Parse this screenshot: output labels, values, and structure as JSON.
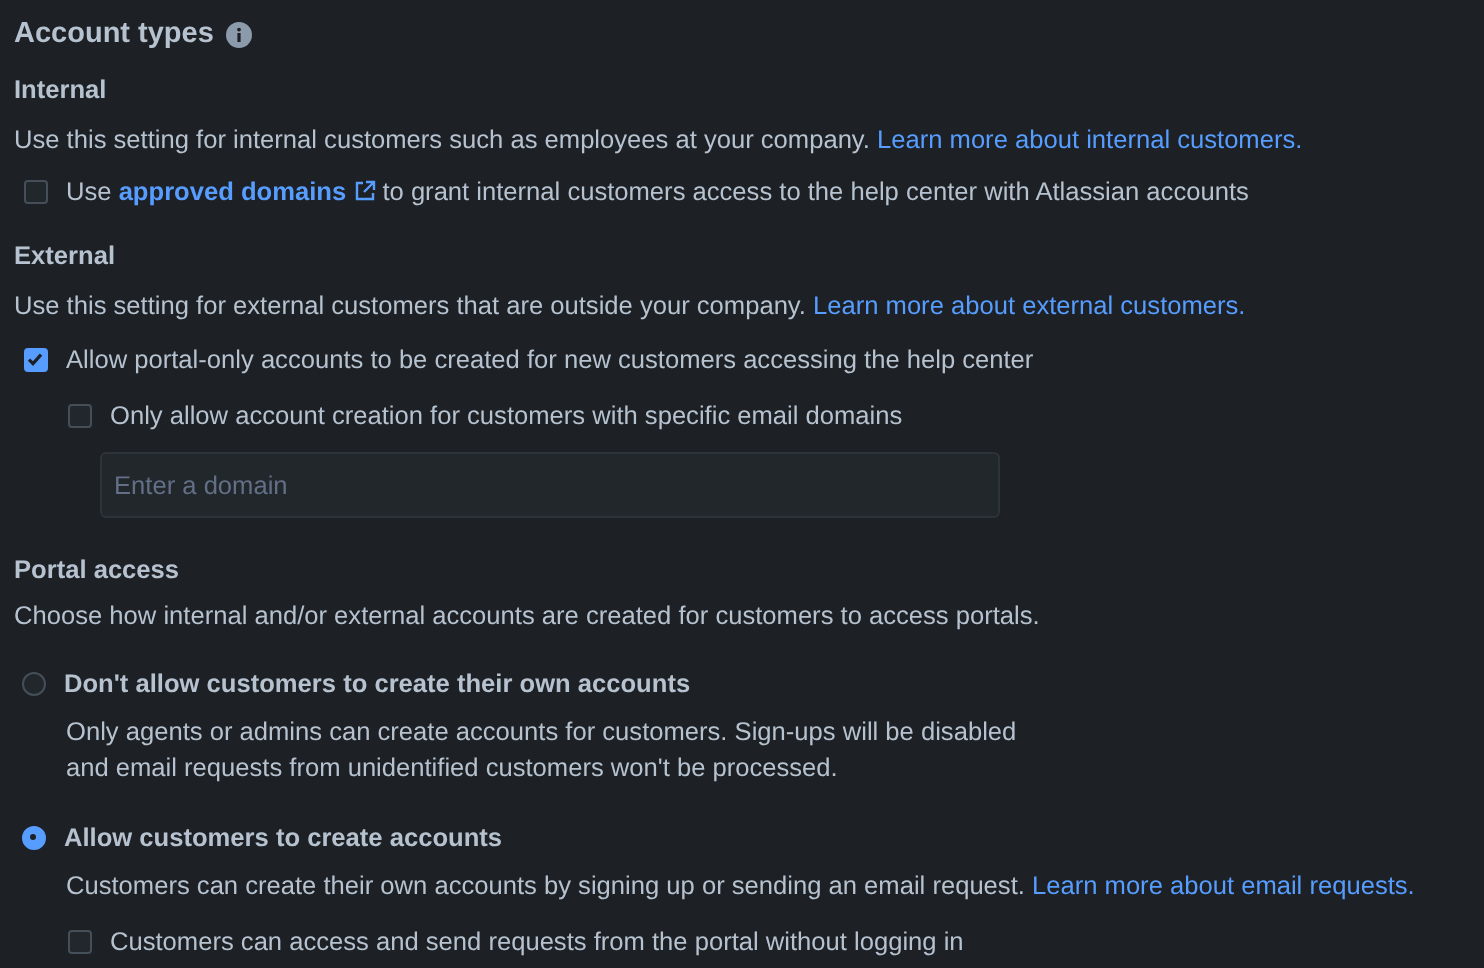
{
  "title": "Account types",
  "internal": {
    "heading": "Internal",
    "description": {
      "text": "Use this setting for internal customers such as employees at your company.",
      "link": "Learn more about internal customers."
    },
    "option": {
      "before": "Use",
      "link": "approved domains",
      "after": "to grant internal customers access to the help center with Atlassian accounts",
      "checked": false
    }
  },
  "external": {
    "heading": "External",
    "description": {
      "text": "Use this setting for external customers that are outside your company.",
      "link": "Learn more about external customers."
    },
    "option": {
      "label": "Allow portal-only accounts to be created for new customers accessing the help center",
      "checked": true
    },
    "sub_option": {
      "label": "Only allow account creation for customers with specific email domains",
      "checked": false
    },
    "domain_field": {
      "placeholder": "Enter a domain"
    }
  },
  "portal_access": {
    "heading": "Portal access",
    "description": "Choose how internal and/or external accounts are created for customers to access portals.",
    "options": [
      {
        "label": "Don't allow customers to create their own accounts",
        "description": "Only agents or admins can create accounts for customers. Sign-ups will be disabled and email requests from unidentified customers won't be processed.",
        "selected": false
      },
      {
        "label": "Allow customers to create accounts",
        "description": "Customers can create their own accounts by signing up or sending an email request.",
        "link": "Learn more about email requests.",
        "selected": true,
        "sub_option": {
          "label": "Customers can access and send requests from the portal without logging in",
          "checked": false
        }
      }
    ]
  }
}
